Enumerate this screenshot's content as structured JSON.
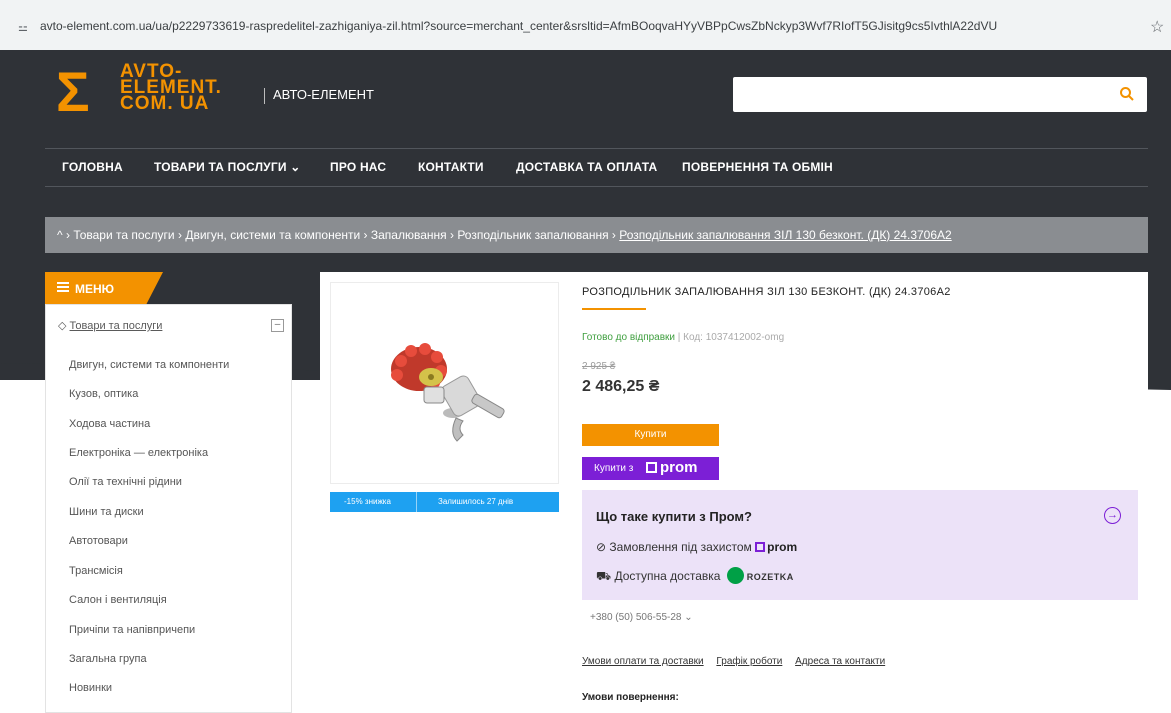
{
  "browser": {
    "url": "avto-element.com.ua/ua/p2229733619-raspredelitel-zazhiganiya-zil.html?source=merchant_center&srsltid=AfmBOoqvaHYyVBPpCwsZbNckyp3Wvf7RIofT5GJisitg9cs5IvthlA22dVU",
    "site_info_icon": "tune-icon",
    "bookmark_icon": "star-icon"
  },
  "header": {
    "logo_symbol": "Σ",
    "logo_lines": [
      "AVTO-",
      "ELEMENT.",
      "COM. UA"
    ],
    "shop_name": "АВТО-ЕЛЕМЕНТ",
    "search_placeholder": "",
    "search_icon": "search-icon",
    "accent_color": "#f39200",
    "dark_color": "#2f3237"
  },
  "nav": {
    "items": [
      "ГОЛОВНА",
      "ТОВАРИ ТА ПОСЛУГИ ⌄",
      "ПРО НАС",
      "КОНТАКТИ",
      "ДОСТАВКА ТА ОПЛАТА",
      "ПОВЕРНЕННЯ ТА ОБМІН"
    ]
  },
  "breadcrumb": {
    "home_icon": "^",
    "items": [
      "Товари та послуги",
      "Двигун, системи та компоненти",
      "Запалювання",
      "Розподільник запалювання"
    ],
    "current": "Розподільник запалювання ЗІЛ 130 безконт. (ДК) 24.3706А2"
  },
  "sidebar": {
    "menu_label": "МЕНЮ",
    "root_bullet": "◇",
    "root": "Товари та послуги",
    "collapse_label": "–",
    "categories": [
      "Двигун, системи та компоненти",
      "Кузов, оптика",
      "Ходова частина",
      "Електроніка — електроніка",
      "Олії та технічні рідини",
      "Шини та диски",
      "Автотовари",
      "Трансмісія",
      "Салон і вентиляція",
      "Причіпи та напівпричепи",
      "Загальна група",
      "Новинки"
    ]
  },
  "product": {
    "title": "РОЗПОДІЛЬНИК ЗАПАЛЮВАННЯ ЗІЛ 130 БЕЗКОНТ. (ДК) 24.3706А2",
    "availability": "Готово до відправки",
    "code": "| Код: 1037412002-omg",
    "old_price": "2 925 ₴",
    "price": "2 486,25 ₴",
    "discount_label": "-15% знижка",
    "remaining_label": "Залишилось 27 днів",
    "buy_label": "Купити",
    "buy_prom_label": "Купити з",
    "prom_logo": "prom"
  },
  "prom_box": {
    "heading": "Що таке купити з Пром?",
    "arrow_icon": "→",
    "row1_icon": "⊘",
    "row1_text": "Замовлення під захистом",
    "row1_logo": "prom",
    "row2_icon": "⛟",
    "row2_text": "Доступна доставка",
    "row2_logo": "ROZETKA",
    "box_color": "#ece2f8",
    "prom_color": "#7c1fd6"
  },
  "contact": {
    "phone": "+380 (50) 506-55-28",
    "phone_dropdown": "⌄",
    "links": [
      "Умови оплати та доставки",
      "Графік роботи",
      "Адреса та контакти"
    ],
    "returns_label": "Умови повернення:"
  }
}
